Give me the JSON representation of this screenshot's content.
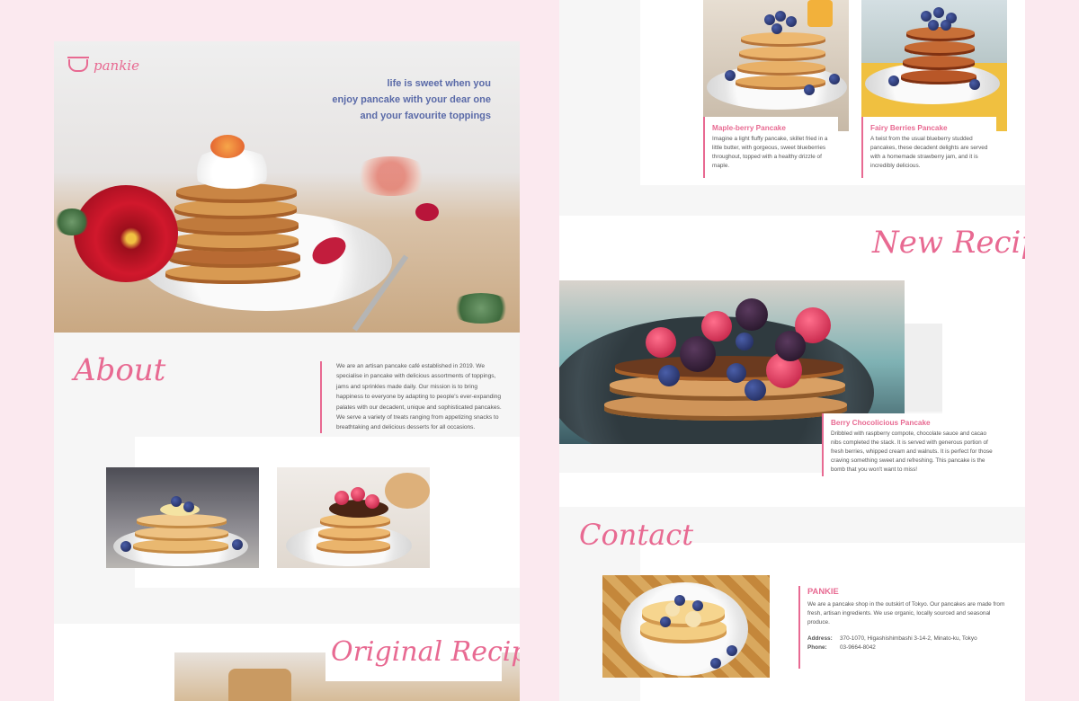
{
  "brand": {
    "logo_text": "pankie"
  },
  "hero": {
    "tagline": [
      "life is sweet when you",
      "enjoy pancake with your dear one",
      "and your favourite toppings"
    ]
  },
  "about": {
    "heading": "About",
    "body": "We are an artisan pancake café established in 2019. We specialise in pancake with delicious assortments of toppings, jams and sprinkles made daily. Our mission is to bring happiness to everyone by adapting to people's ever-expanding palates with our decadent, unique and sophisticated pancakes. We serve a variety of treats ranging from appetizing snacks to breathtaking and delicious desserts for all occasions."
  },
  "original_recipes": {
    "heading": "Original Recipes"
  },
  "recipes": [
    {
      "title": "Maple-berry Pancake",
      "description": "Imagine a light fluffy pancake, skillet fried in a little butter, with gorgeous, sweet blueberries throughout, topped with a healthy drizzle of maple."
    },
    {
      "title": "Fairy Berries Pancake",
      "description": "A twist from the usual blueberry studded pancakes, these decadent delights are served with a homemade strawberry jam, and it is incredibly delicious."
    }
  ],
  "new_recipes": {
    "heading": "New Recipes",
    "featured": {
      "title": "Berry Chocolicious Pancake",
      "description": "Dribbled with raspberry compote, chocolate sauce and cacao nibs completed the stack. It is served with generous portion of fresh berries, whipped cream and walnuts. It is perfect for those craving something sweet and refreshing. This pancake is the bomb that you won't want to miss!"
    }
  },
  "contact": {
    "heading": "Contact",
    "name": "PANKIE",
    "description": "We are a pancake shop in the outskirt of Tokyo. Our pancakes are made from fresh, artisan ingredients. We use organic, locally sourced and seasonal produce.",
    "address_label": "Address:",
    "address_value": "370-1070, Higashishimbashi 3-14-2, Minato-ku, Tokyo",
    "phone_label": "Phone:",
    "phone_value": "03-9664-8042"
  },
  "colors": {
    "accent": "#e86a92",
    "tagline": "#5a6aa8",
    "background": "#fbe9ef"
  }
}
